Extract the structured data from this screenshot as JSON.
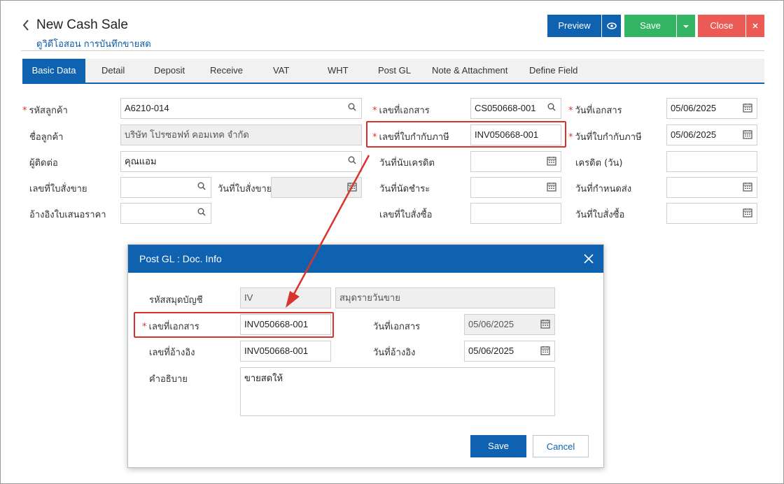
{
  "header": {
    "back_icon": "chevron-left-icon",
    "title": "New Cash Sale",
    "subtitle": "ดูวิดีโอสอน การบันทึกขายสด",
    "preview_label": "Preview",
    "save_label": "Save",
    "close_label": "Close"
  },
  "tabs": [
    "Basic Data",
    "Detail",
    "Deposit",
    "Receive",
    "VAT",
    "WHT",
    "Post GL",
    "Note & Attachment",
    "Define Field"
  ],
  "form": {
    "customer_code_label": "รหัสลูกค้า",
    "customer_code_value": "A6210-014",
    "customer_name_label": "ชื่อลูกค้า",
    "customer_name_value": "บริษัท โปรซอฟท์ คอมเทค จำกัด",
    "contact_label": "ผู้ติดต่อ",
    "contact_value": "คุณแอม",
    "sales_order_no_label": "เลขที่ใบสั่งขาย",
    "sales_order_date_label": "วันที่ใบสั่งขาย",
    "quotation_ref_label": "อ้างอิงใบเสนอราคา",
    "doc_no_label": "เลขที่เอกสาร",
    "doc_no_value": "CS050668-001",
    "tax_invoice_no_label": "เลขที่ใบกำกับภาษี",
    "tax_invoice_no_value": "INV050668-001",
    "credit_start_label": "วันที่นับเครดิต",
    "payment_due_label": "วันที่นัดชำระ",
    "purchase_order_no_label": "เลขที่ใบสั่งซื้อ",
    "doc_date_label": "วันที่เอกสาร",
    "doc_date_value": "05/06/2025",
    "tax_invoice_date_label": "วันที่ใบกำกับภาษี",
    "tax_invoice_date_value": "05/06/2025",
    "credit_days_label": "เครดิต (วัน)",
    "delivery_date_label": "วันที่กำหนดส่ง",
    "purchase_order_date_label": "วันที่ใบสั่งซื้อ"
  },
  "dialog": {
    "title": "Post GL : Doc. Info",
    "journal_code_label": "รหัสสมุดบัญชี",
    "journal_code_value": "IV",
    "journal_name_value": "สมุดรายวันขาย",
    "doc_no_label": "เลขที่เอกสาร",
    "doc_no_value": "INV050668-001",
    "doc_date_label": "วันที่เอกสาร",
    "doc_date_value": "05/06/2025",
    "ref_no_label": "เลขที่อ้างอิง",
    "ref_no_value": "INV050668-001",
    "ref_date_label": "วันที่อ้างอิง",
    "ref_date_value": "05/06/2025",
    "description_label": "คำอธิบาย",
    "description_value": "ขายสดให้",
    "save_label": "Save",
    "cancel_label": "Cancel"
  },
  "colors": {
    "primary": "#0e62b0",
    "success": "#34b563",
    "danger": "#ec5a55",
    "highlight": "#d9342b"
  }
}
